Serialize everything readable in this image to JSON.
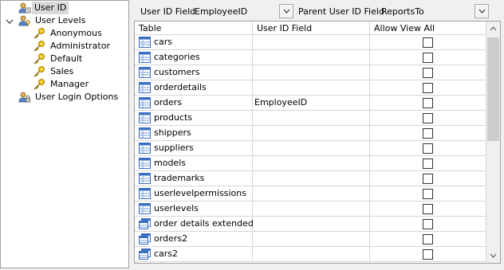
{
  "tree": {
    "items": [
      {
        "label": "User ID",
        "icon": "user-id-icon",
        "level": 0,
        "selected": true
      },
      {
        "label": "User Levels",
        "icon": "user-levels-icon",
        "level": 0,
        "expanded": true
      },
      {
        "label": "Anonymous",
        "icon": "key-icon",
        "level": 1
      },
      {
        "label": "Administrator",
        "icon": "key-icon",
        "level": 1
      },
      {
        "label": "Default",
        "icon": "key-icon",
        "level": 1
      },
      {
        "label": "Sales",
        "icon": "key-icon",
        "level": 1
      },
      {
        "label": "Manager",
        "icon": "key-icon",
        "level": 1
      },
      {
        "label": "User Login Options",
        "icon": "user-login-icon",
        "level": 0
      }
    ]
  },
  "toolbar": {
    "user_id_field_label": "User ID Field",
    "user_id_field_value": "EmployeeID",
    "parent_user_id_field_label": "Parent User ID Field",
    "parent_user_id_field_value": "ReportsTo"
  },
  "grid": {
    "columns": [
      "Table",
      "User ID Field",
      "Allow View All"
    ],
    "rows": [
      {
        "table": "cars",
        "user_id_field": "",
        "type": "table",
        "allow_view_all": false
      },
      {
        "table": "categories",
        "user_id_field": "",
        "type": "table",
        "allow_view_all": false
      },
      {
        "table": "customers",
        "user_id_field": "",
        "type": "table",
        "allow_view_all": false
      },
      {
        "table": "orderdetails",
        "user_id_field": "",
        "type": "table",
        "allow_view_all": false
      },
      {
        "table": "orders",
        "user_id_field": "EmployeeID",
        "type": "table",
        "allow_view_all": false
      },
      {
        "table": "products",
        "user_id_field": "",
        "type": "table",
        "allow_view_all": false
      },
      {
        "table": "shippers",
        "user_id_field": "",
        "type": "table",
        "allow_view_all": false
      },
      {
        "table": "suppliers",
        "user_id_field": "",
        "type": "table",
        "allow_view_all": false
      },
      {
        "table": "models",
        "user_id_field": "",
        "type": "table",
        "allow_view_all": false
      },
      {
        "table": "trademarks",
        "user_id_field": "",
        "type": "table",
        "allow_view_all": false
      },
      {
        "table": "userlevelpermissions",
        "user_id_field": "",
        "type": "table",
        "allow_view_all": false
      },
      {
        "table": "userlevels",
        "user_id_field": "",
        "type": "table",
        "allow_view_all": false
      },
      {
        "table": "order details extended",
        "user_id_field": "",
        "type": "view",
        "allow_view_all": false
      },
      {
        "table": "orders2",
        "user_id_field": "",
        "type": "view",
        "allow_view_all": false
      },
      {
        "table": "cars2",
        "user_id_field": "",
        "type": "view",
        "allow_view_all": false
      }
    ]
  },
  "colors": {
    "key_icon": "#d9a400",
    "table_icon": "#3a6fc4",
    "selection": "#d9d9d9",
    "grid_line": "#d6d6d6"
  }
}
